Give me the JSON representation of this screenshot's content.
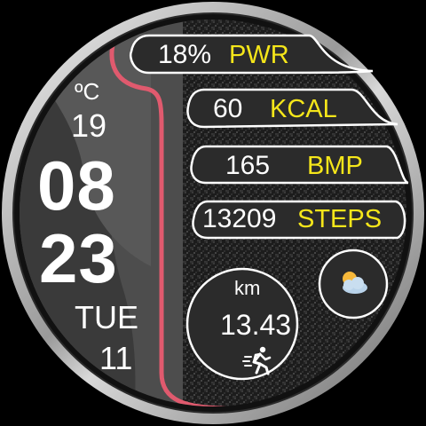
{
  "weather": {
    "unit": "ºC",
    "temperature": "19",
    "icon": "partly-cloudy-icon"
  },
  "time": {
    "hour": "08",
    "minute": "23"
  },
  "date": {
    "weekday": "TUE",
    "day": "11"
  },
  "stats": {
    "power": {
      "value": "18%",
      "label": "PWR"
    },
    "calories": {
      "value": "60",
      "label": "KCAL"
    },
    "heart_rate": {
      "value": "165",
      "label": "BMP"
    },
    "steps": {
      "value": "13209",
      "label": "STEPS"
    }
  },
  "distance": {
    "unit": "km",
    "value": "13.43",
    "icon": "running-man-icon"
  },
  "colors": {
    "accent": "#e05a6e",
    "label": "#f5e61a",
    "text": "#ffffff",
    "panel": "#4a4a4a"
  }
}
